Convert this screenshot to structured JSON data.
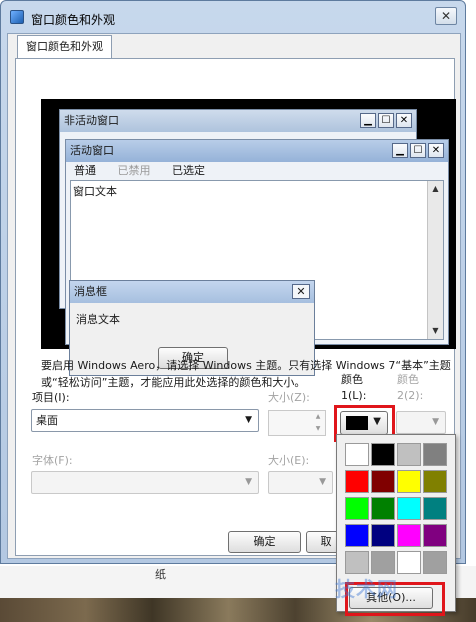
{
  "window": {
    "title": "窗口颜色和外观",
    "close_glyph": "✕"
  },
  "tab": {
    "label": "窗口颜色和外观"
  },
  "preview": {
    "inactive_title": "非活动窗口",
    "active_title": "活动窗口",
    "menu": {
      "normal": "普通",
      "disabled": "已禁用",
      "selected": "已选定"
    },
    "window_text": "窗口文本",
    "message_box": {
      "title": "消息框",
      "text": "消息文本",
      "ok": "确定"
    },
    "buttons": {
      "minimize": "▁",
      "maximize": "☐",
      "close": "✕"
    }
  },
  "info_text": "要启用 Windows Aero，请选择 Windows 主题。只有选择 Windows 7“基本”主题或“轻松访问”主题，才能应用此处选择的颜色和大小。",
  "item": {
    "label": "项目(I):",
    "value": "桌面"
  },
  "size1": {
    "label": "大小(Z):"
  },
  "color1": {
    "label_line1": "颜色",
    "label_line2": "1(L):",
    "value": "#000000"
  },
  "color2": {
    "label_line1": "颜色",
    "label_line2": "2(2):"
  },
  "font": {
    "label": "字体(F):",
    "value": ""
  },
  "size2": {
    "label": "大小(E):"
  },
  "buttons": {
    "ok": "确定",
    "cancel_partial": "取"
  },
  "picker": {
    "colors": [
      "#ffffff",
      "#000000",
      "#c0c0c0",
      "#808080",
      "#ff0000",
      "#800000",
      "#ffff00",
      "#808000",
      "#00ff00",
      "#008000",
      "#00ffff",
      "#008080",
      "#0000ff",
      "#000080",
      "#ff00ff",
      "#800080",
      "#c0c0c0",
      "#a0a0a0",
      "#ffffff",
      "#a0a0a0"
    ],
    "more_label": "其他(O)..."
  },
  "desktop": {
    "label": "纸",
    "watermark": "技术网"
  }
}
